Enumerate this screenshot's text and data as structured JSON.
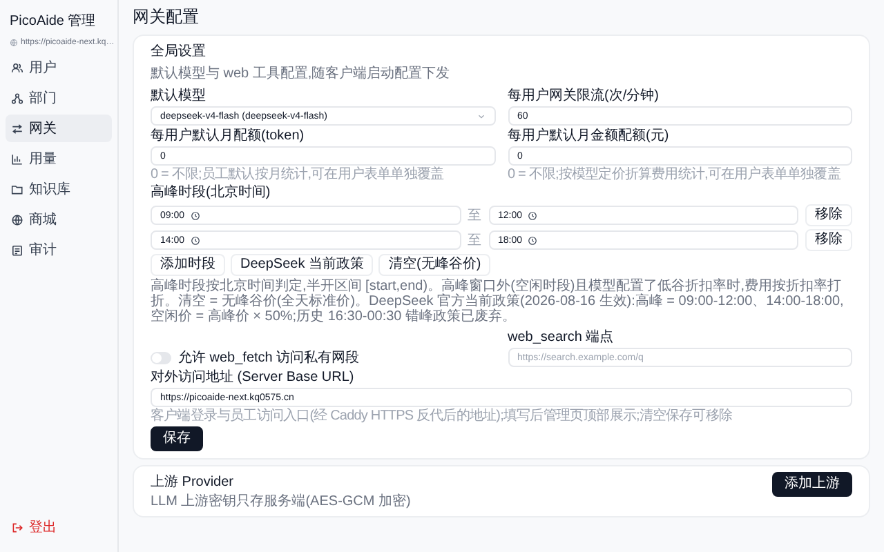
{
  "sidebar": {
    "title": "PicoAide 管理",
    "url": "https://picoaide-next.kq…",
    "items": [
      {
        "label": "用户",
        "selected": false
      },
      {
        "label": "部门",
        "selected": false
      },
      {
        "label": "网关",
        "selected": true
      },
      {
        "label": "用量",
        "selected": false
      },
      {
        "label": "知识库",
        "selected": false
      },
      {
        "label": "商城",
        "selected": false
      },
      {
        "label": "审计",
        "selected": false
      }
    ],
    "logout": "登出"
  },
  "page_title": "网关配置",
  "global_card": {
    "title": "全局设置",
    "subtitle": "默认模型与 web 工具配置,随客户端启动配置下发",
    "default_model": {
      "label": "默认模型",
      "value": "deepseek-v4-flash (deepseek-v4-flash)"
    },
    "rate_limit": {
      "label": "每用户网关限流(次/分钟)",
      "value": "60"
    },
    "token_quota": {
      "label": "每用户默认月配额(token)",
      "value": "0",
      "hint": "0 = 不限;员工默认按月统计,可在用户表单单独覆盖"
    },
    "money_quota": {
      "label": "每用户默认月金额配额(元)",
      "value": "0",
      "hint": "0 = 不限;按模型定价折算费用统计,可在用户表单单独覆盖"
    },
    "peak_label": "高峰时段(北京时间)",
    "peak_ranges": [
      {
        "start": "09:00",
        "separator": "至",
        "end": "12:00",
        "remove": "移除"
      },
      {
        "start": "14:00",
        "separator": "至",
        "end": "18:00",
        "remove": "移除"
      }
    ],
    "peak_buttons": [
      "添加时段",
      "DeepSeek 当前政策",
      "清空(无峰谷价)"
    ],
    "peak_note": "高峰时段按北京时间判定,半开区间 [start,end)。高峰窗口外(空闲时段)且模型配置了低谷折扣率时,费用按折扣率打折。清空 = 无峰谷价(全天标准价)。DeepSeek 官方当前政策(2026-08-16 生效):高峰 = 09:00-12:00、14:00-18:00,空闲价 = 高峰价 × 50%;历史 16:30-00:30 错峰政策已废弃。",
    "web_fetch_toggle": {
      "label": "允许 web_fetch 访问私有网段",
      "on": false
    },
    "web_search": {
      "label": "web_search 端点",
      "placeholder": "https://search.example.com/q"
    },
    "server_url": {
      "label": "对外访问地址 (Server Base URL)",
      "value": "https://picoaide-next.kq0575.cn",
      "hint": "客户端登录与员工访问入口(经 Caddy HTTPS 反代后的地址);填写后管理页顶部展示;清空保存可移除"
    },
    "save_button": "保存"
  },
  "provider_card": {
    "title": "上游 Provider",
    "subtitle": "LLM 上游密钥只存服务端(AES-GCM 加密)",
    "add_button": "添加上游"
  }
}
